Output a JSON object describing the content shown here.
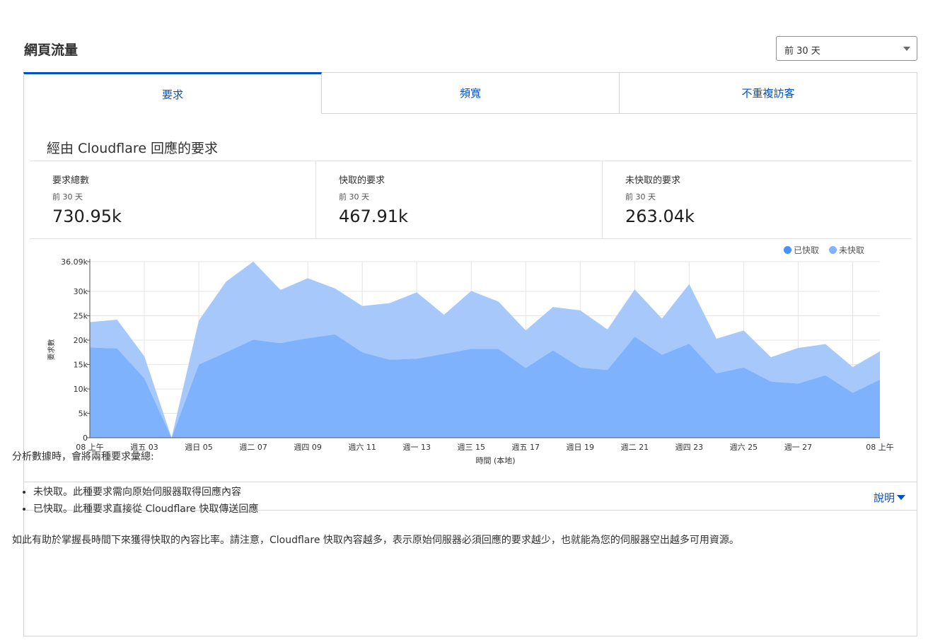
{
  "header": {
    "title": "網頁流量",
    "range_select": {
      "value": "前 30 天"
    }
  },
  "tabs": [
    {
      "label": "要求",
      "active": true
    },
    {
      "label": "頻寬",
      "active": false
    },
    {
      "label": "不重複訪客",
      "active": false
    }
  ],
  "section": {
    "title": "經由 Cloudflare 回應的要求"
  },
  "stats": [
    {
      "label": "要求總數",
      "period": "前 30 天",
      "value": "730.95k"
    },
    {
      "label": "快取的要求",
      "period": "前 30 天",
      "value": "467.91k"
    },
    {
      "label": "未快取的要求",
      "period": "前 30 天",
      "value": "263.04k"
    }
  ],
  "colors": {
    "accent": "#0051c3",
    "cached": "#4693ff",
    "uncached": "#80b4ff"
  },
  "chart_data": {
    "type": "area",
    "stacked": true,
    "x": [
      "08 上午",
      "",
      "",
      "週五 03",
      "",
      "週日 05",
      "",
      "週二 07",
      "",
      "週四 09",
      "",
      "週六 11",
      "",
      "週一 13",
      "",
      "週三 15",
      "",
      "週五 17",
      "",
      "週日 19",
      "",
      "週二 21",
      "",
      "週四 23",
      "",
      "週六 25",
      "",
      "週一 27",
      "",
      "08 上午"
    ],
    "series": [
      {
        "name": "已快取",
        "values": [
          18500,
          18300,
          12200,
          0,
          15000,
          17500,
          20100,
          19400,
          20400,
          21200,
          17500,
          16000,
          16200,
          17200,
          18200,
          18200,
          14300,
          17900,
          14400,
          13900,
          20700,
          17000,
          19300,
          13200,
          14400,
          11500,
          11100,
          12800,
          9200,
          11900
        ]
      },
      {
        "name": "未快取",
        "values": [
          5200,
          5900,
          4500,
          0,
          9000,
          14500,
          16000,
          10900,
          12300,
          9400,
          9500,
          11600,
          13600,
          8000,
          11900,
          9700,
          7700,
          8900,
          11700,
          8300,
          9700,
          7400,
          12200,
          7100,
          7600,
          5000,
          7300,
          6400,
          5300,
          5800
        ]
      }
    ],
    "xtick_labels": [
      "08 上午",
      "週五 03",
      "週日 05",
      "週二 07",
      "週四 09",
      "週六 11",
      "週一 13",
      "週三 15",
      "週五 17",
      "週日 19",
      "週二 21",
      "週四 23",
      "週六 25",
      "週一 27",
      "08 上午"
    ],
    "ytick_labels": [
      "0",
      "5k",
      "10k",
      "15k",
      "20k",
      "25k",
      "30k",
      "36.09k"
    ],
    "yticks": [
      0,
      5000,
      10000,
      15000,
      20000,
      25000,
      30000,
      36090
    ],
    "ylim": [
      0,
      36090
    ],
    "xlabel": "時間 (本地)",
    "ylabel": "要求數",
    "legend": [
      "已快取",
      "未快取"
    ],
    "legend_position": "top-right",
    "grid": true
  },
  "explain": {
    "link_label": "說明",
    "intro": "分析數據時，會將兩種要求彙總:",
    "items": [
      "未快取。此種要求需向原始伺服器取得回應內容",
      "已快取。此種要求直接從 Cloudflare 快取傳送回應"
    ],
    "note": "如此有助於掌握長時間下來獲得快取的內容比率。請注意，Cloudflare 快取內容越多，表示原始伺服器必須回應的要求越少，也就能為您的伺服器空出越多可用資源。"
  }
}
